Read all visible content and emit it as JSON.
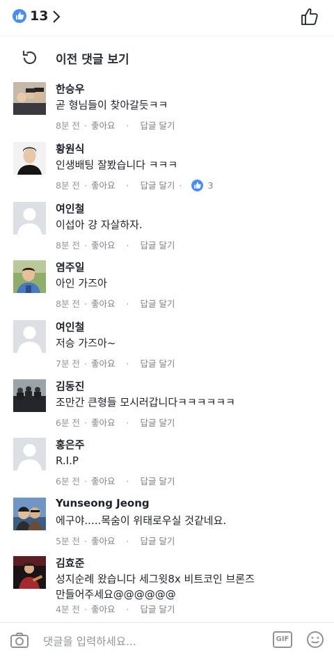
{
  "header": {
    "like_count": "13"
  },
  "prev_comments_label": "이전 댓글 보기",
  "comments": [
    {
      "name": "한승우",
      "text": "곧 형님들이 찾아갈듯ㅋㅋ",
      "time": "8분 전",
      "like": "좋아요",
      "reply": "답글 달기",
      "avatar": "photo-group"
    },
    {
      "name": "황원식",
      "text": "인생배팅 잘봤습니다 ㅋㅋㅋ",
      "time": "8분 전",
      "like": "좋아요",
      "reply": "답글 달기",
      "reactions": "3",
      "avatar": "photo-man"
    },
    {
      "name": "여인철",
      "text": "이섭아 걍 자살하자.",
      "time": "8분 전",
      "like": "좋아요",
      "reply": "답글 달기",
      "avatar": "default"
    },
    {
      "name": "염주일",
      "text": "아인 가즈아",
      "time": "8분 전",
      "like": "좋아요",
      "reply": "답글 달기",
      "avatar": "photo-outdoor"
    },
    {
      "name": "여인철",
      "text": "저승 가즈아~",
      "time": "7분 전",
      "like": "좋아요",
      "reply": "답글 달기",
      "avatar": "default"
    },
    {
      "name": "김동진",
      "text": "조만간 큰형들 모시러갑니다ㅋㅋㅋㅋㅋㅋ",
      "time": "6분 전",
      "like": "좋아요",
      "reply": "답글 달기",
      "avatar": "photo-dark"
    },
    {
      "name": "홍은주",
      "text": "R.I.P",
      "time": "6분 전",
      "like": "좋아요",
      "reply": "답글 달기",
      "avatar": "default"
    },
    {
      "name": "Yunseong Jeong",
      "text": "에구야.....목숨이 위태로우실 것같네요.",
      "time": "5분 전",
      "like": "좋아요",
      "reply": "답글 달기",
      "avatar": "photo-couple"
    },
    {
      "name": "김효준",
      "text": "성지순례 왔습니다 세그윗8x 비트코인 브론즈 만들어주세요@@@@@@",
      "time": "4분 전",
      "like": "좋아요",
      "reply": "답글 달기",
      "avatar": "photo-red"
    }
  ],
  "composer": {
    "placeholder": "댓글을 입력하세요...",
    "gif_label": "GIF"
  },
  "colors": {
    "accent": "#4a8ef5",
    "meta": "#90949c"
  },
  "icons": [
    "like-badge-icon",
    "chevron-right-icon",
    "thumbs-up-icon",
    "refresh-icon",
    "camera-icon",
    "gif-icon",
    "emoji-icon"
  ]
}
